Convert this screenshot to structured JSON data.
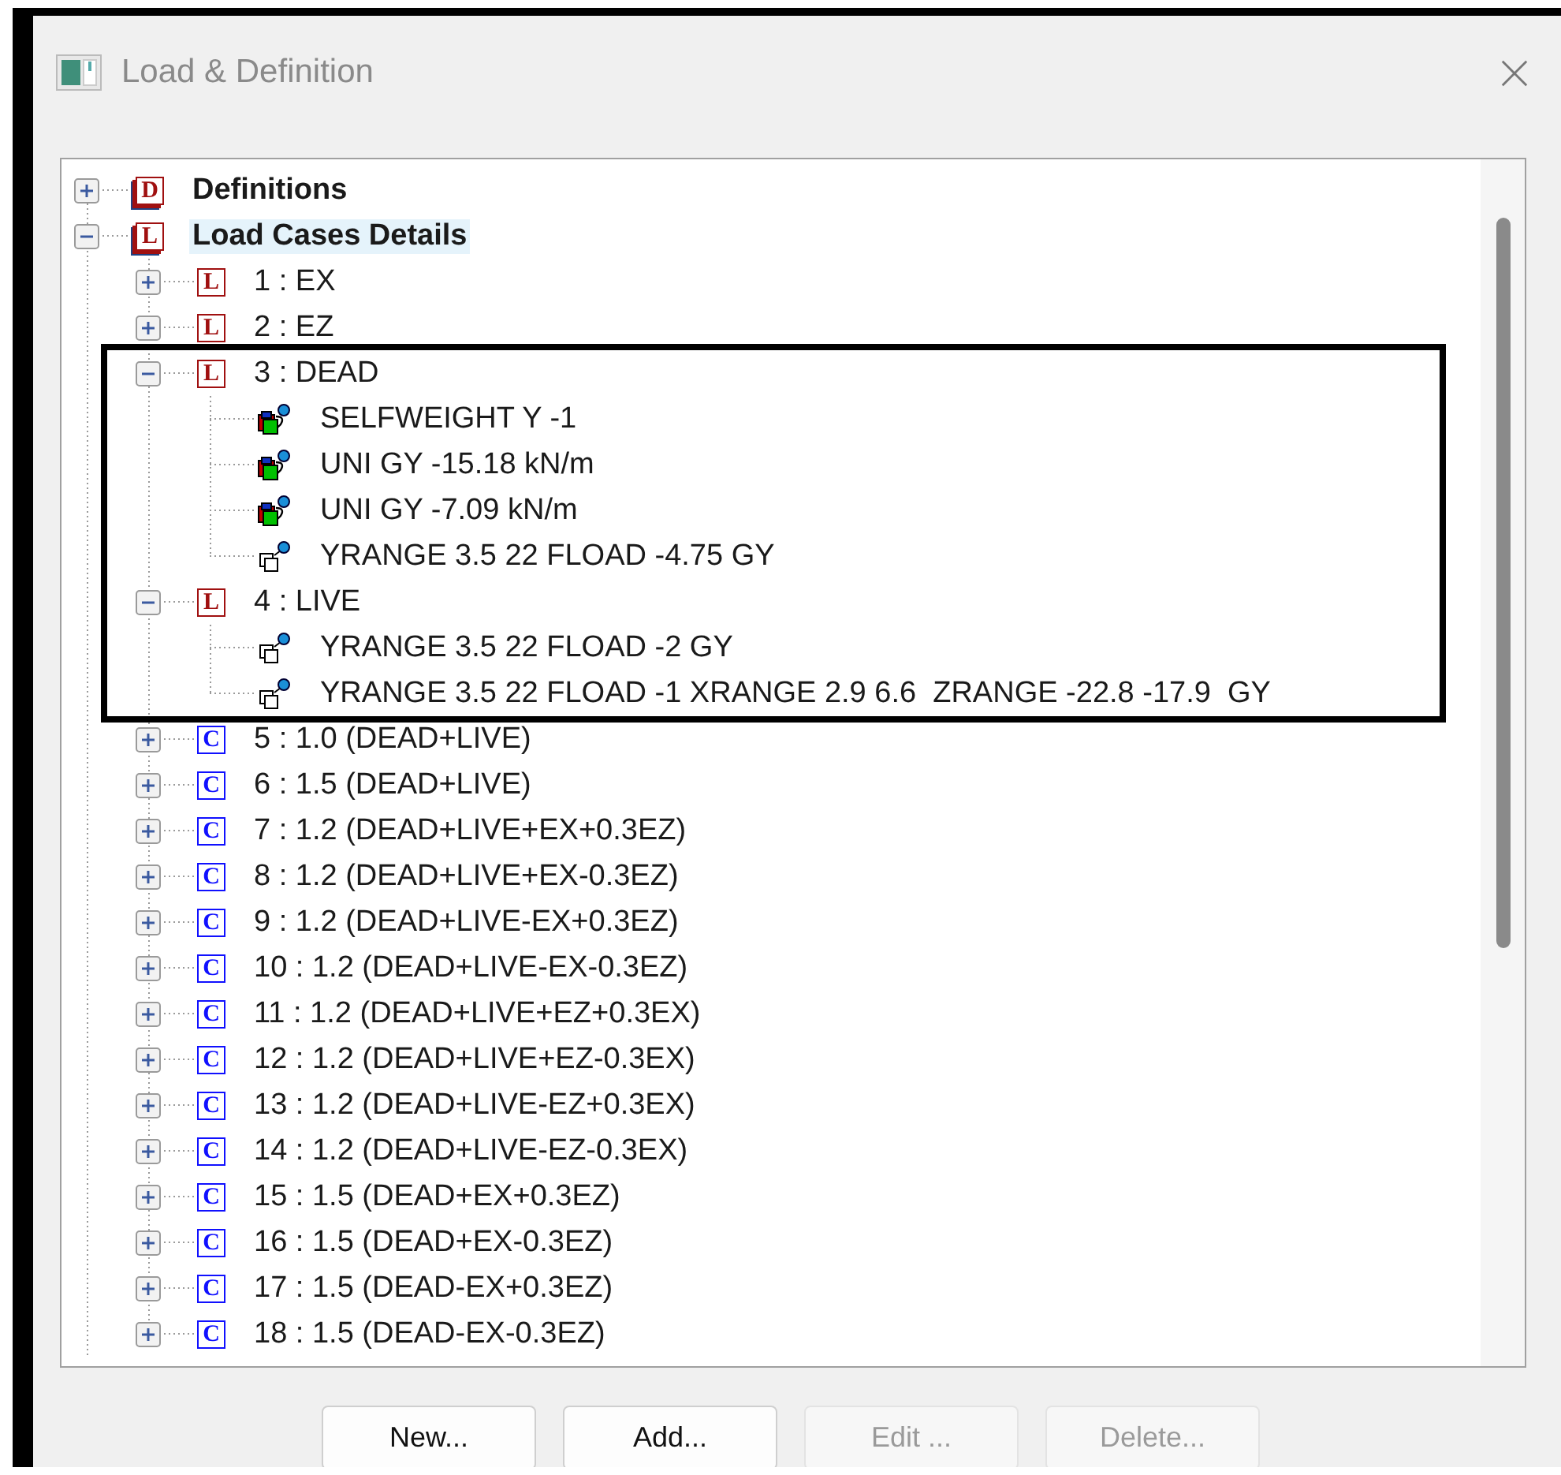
{
  "window": {
    "title": "Load & Definition"
  },
  "tree": [
    {
      "kind": "group",
      "badge": "D",
      "label": "Definitions",
      "expanded": false,
      "selected": false
    },
    {
      "kind": "group",
      "badge": "L",
      "label": "Load Cases Details",
      "expanded": true,
      "selected": true,
      "children": [
        {
          "kind": "load_case",
          "badge": "L",
          "label": "1 : EX",
          "expanded": false,
          "selected": false
        },
        {
          "kind": "load_case",
          "badge": "L",
          "label": "2 : EZ",
          "expanded": false,
          "selected": false
        },
        {
          "kind": "load_case",
          "badge": "L",
          "label": "3 : DEAD",
          "expanded": true,
          "selected": false,
          "framed": true,
          "children": [
            {
              "kind": "member_load",
              "label": "SELFWEIGHT Y -1",
              "selected": false
            },
            {
              "kind": "member_load",
              "label": "UNI GY -15.18 kN/m",
              "selected": false
            },
            {
              "kind": "member_load",
              "label": "UNI GY -7.09 kN/m",
              "selected": false
            },
            {
              "kind": "floor_load",
              "label": "YRANGE 3.5 22 FLOAD -4.75 GY",
              "selected": false
            }
          ]
        },
        {
          "kind": "load_case",
          "badge": "L",
          "label": "4 : LIVE",
          "expanded": true,
          "selected": false,
          "framed": true,
          "children": [
            {
              "kind": "floor_load",
              "label": "YRANGE 3.5 22 FLOAD -2 GY",
              "selected": false
            },
            {
              "kind": "floor_load",
              "label": "YRANGE 3.5 22 FLOAD -1 XRANGE 2.9 6.6  ZRANGE -22.8 -17.9  GY",
              "selected": false
            }
          ]
        },
        {
          "kind": "combination",
          "badge": "C",
          "label": "5 : 1.0 (DEAD+LIVE)",
          "expanded": false,
          "selected": false
        },
        {
          "kind": "combination",
          "badge": "C",
          "label": "6 : 1.5 (DEAD+LIVE)",
          "expanded": false,
          "selected": false
        },
        {
          "kind": "combination",
          "badge": "C",
          "label": "7 : 1.2 (DEAD+LIVE+EX+0.3EZ)",
          "expanded": false,
          "selected": false
        },
        {
          "kind": "combination",
          "badge": "C",
          "label": "8 : 1.2 (DEAD+LIVE+EX-0.3EZ)",
          "expanded": false,
          "selected": false
        },
        {
          "kind": "combination",
          "badge": "C",
          "label": "9 : 1.2 (DEAD+LIVE-EX+0.3EZ)",
          "expanded": false,
          "selected": false
        },
        {
          "kind": "combination",
          "badge": "C",
          "label": "10 : 1.2 (DEAD+LIVE-EX-0.3EZ)",
          "expanded": false,
          "selected": false
        },
        {
          "kind": "combination",
          "badge": "C",
          "label": "11 : 1.2 (DEAD+LIVE+EZ+0.3EX)",
          "expanded": false,
          "selected": false
        },
        {
          "kind": "combination",
          "badge": "C",
          "label": "12 : 1.2 (DEAD+LIVE+EZ-0.3EX)",
          "expanded": false,
          "selected": false
        },
        {
          "kind": "combination",
          "badge": "C",
          "label": "13 : 1.2 (DEAD+LIVE-EZ+0.3EX)",
          "expanded": false,
          "selected": false
        },
        {
          "kind": "combination",
          "badge": "C",
          "label": "14 : 1.2 (DEAD+LIVE-EZ-0.3EX)",
          "expanded": false,
          "selected": false
        },
        {
          "kind": "combination",
          "badge": "C",
          "label": "15 : 1.5 (DEAD+EX+0.3EZ)",
          "expanded": false,
          "selected": false
        },
        {
          "kind": "combination",
          "badge": "C",
          "label": "16 : 1.5 (DEAD+EX-0.3EZ)",
          "expanded": false,
          "selected": false
        },
        {
          "kind": "combination",
          "badge": "C",
          "label": "17 : 1.5 (DEAD-EX+0.3EZ)",
          "expanded": false,
          "selected": false
        },
        {
          "kind": "combination",
          "badge": "C",
          "label": "18 : 1.5 (DEAD-EX-0.3EZ)",
          "expanded": false,
          "selected": false
        }
      ]
    }
  ],
  "buttons": [
    {
      "label": "New...",
      "disabled": false
    },
    {
      "label": "Add...",
      "disabled": false
    },
    {
      "label": "Edit ...",
      "disabled": true
    },
    {
      "label": "Delete...",
      "disabled": true
    }
  ]
}
